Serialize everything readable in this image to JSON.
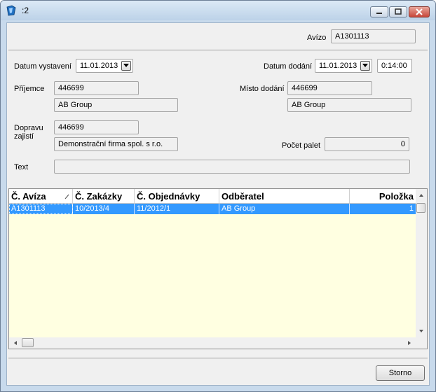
{
  "window": {
    "title": ":2"
  },
  "header": {
    "aviso_label": "Avízo",
    "aviso_value": "A1301113"
  },
  "form": {
    "datum_vystaveni_label": "Datum vystavení",
    "datum_vystaveni_value": "11.01.2013",
    "datum_dodani_label": "Datum dodání",
    "datum_dodani_value": "11.01.2013",
    "cas_dodani_value": "0:14:00",
    "prijemce_label": "Příjemce",
    "prijemce_code": "446699",
    "prijemce_name": "AB Group",
    "misto_dodani_label": "Místo dodání",
    "misto_dodani_code": "446699",
    "misto_dodani_name": "AB Group",
    "dopravu_label_line1": "Dopravu",
    "dopravu_label_line2": "zajistí",
    "dopravu_code": "446699",
    "dopravu_name": "Demonstrační firma spol. s r.o.",
    "pocet_palet_label": "Počet palet",
    "pocet_palet_value": "0",
    "text_label": "Text",
    "text_value": ""
  },
  "table": {
    "columns": [
      "Č. Avíza",
      "Č. Zakázky",
      "Č. Objednávky",
      "Odběratel",
      "Položka"
    ],
    "rows": [
      [
        "A1301113",
        "10/2013/4",
        "11/2012/1",
        "AB Group",
        "1"
      ]
    ]
  },
  "footer": {
    "storno_label": "Storno"
  },
  "colors": {
    "selection": "#3399ff",
    "grid_background": "#ffffe1",
    "titlebar": "#c8daec"
  }
}
